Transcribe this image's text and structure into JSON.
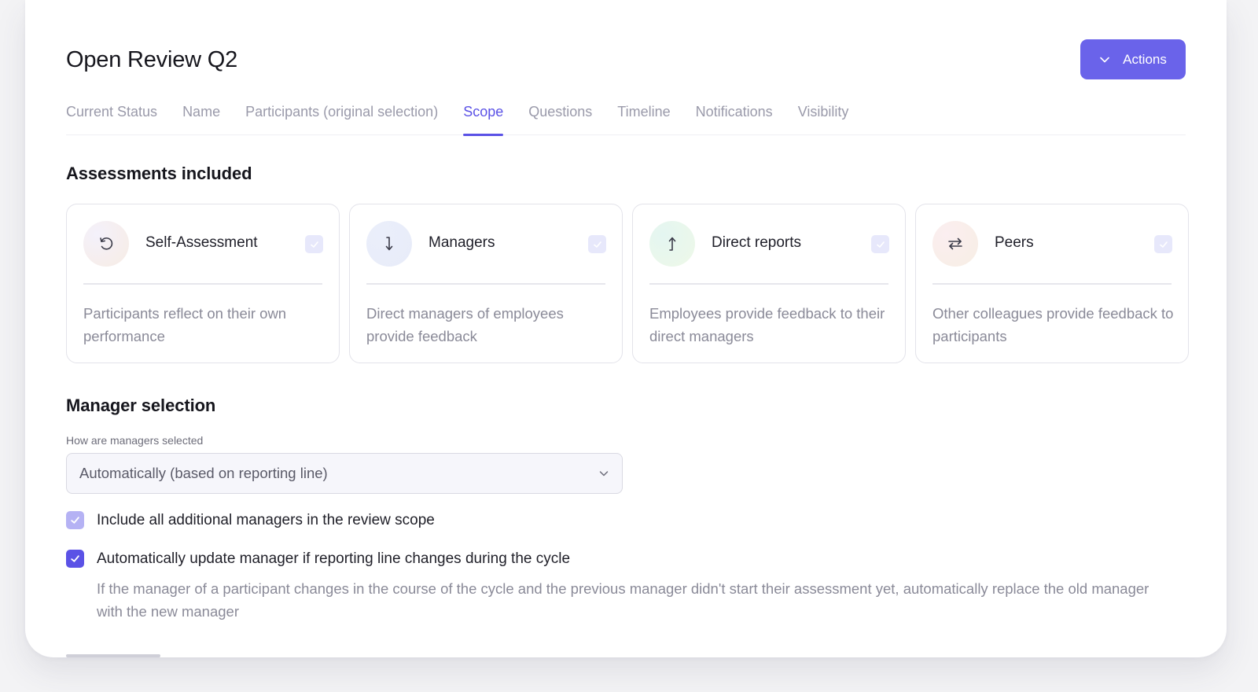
{
  "page": {
    "title": "Open Review Q2",
    "actions_label": "Actions"
  },
  "tabs": [
    {
      "label": "Current Status",
      "active": false
    },
    {
      "label": "Name",
      "active": false
    },
    {
      "label": "Participants (original selection)",
      "active": false
    },
    {
      "label": "Scope",
      "active": true
    },
    {
      "label": "Questions",
      "active": false
    },
    {
      "label": "Timeline",
      "active": false
    },
    {
      "label": "Notifications",
      "active": false
    },
    {
      "label": "Visibility",
      "active": false
    }
  ],
  "assessments": {
    "heading": "Assessments included",
    "cards": [
      {
        "name": "Self-Assessment",
        "description": "Participants reflect on their own performance",
        "icon": "rotate-ccw-icon",
        "checked": true
      },
      {
        "name": "Managers",
        "description": "Direct managers of employees provide feedback",
        "icon": "arrow-down-icon",
        "checked": true
      },
      {
        "name": "Direct reports",
        "description": "Employees provide feedback to their direct managers",
        "icon": "arrow-up-icon",
        "checked": true
      },
      {
        "name": "Peers",
        "description": "Other colleagues provide feedback to participants",
        "icon": "swap-arrows-icon",
        "checked": true
      }
    ]
  },
  "manager_selection": {
    "heading": "Manager selection",
    "field_label": "How are managers selected",
    "selected_value": "Automatically (based on reporting line)",
    "option_include_additional": {
      "label": "Include all additional managers in the review scope",
      "checked": true,
      "state": "disabled"
    },
    "option_auto_update": {
      "label": "Automatically update manager if reporting line changes during the cycle",
      "checked": true,
      "help": "If the manager of a participant changes in the course of the cycle and the previous manager didn't start their assessment yet, automatically replace the old manager with the new manager"
    }
  },
  "colors": {
    "accent": "#5b52e6",
    "button": "#6a63ea",
    "muted_text": "#8a8a98"
  }
}
